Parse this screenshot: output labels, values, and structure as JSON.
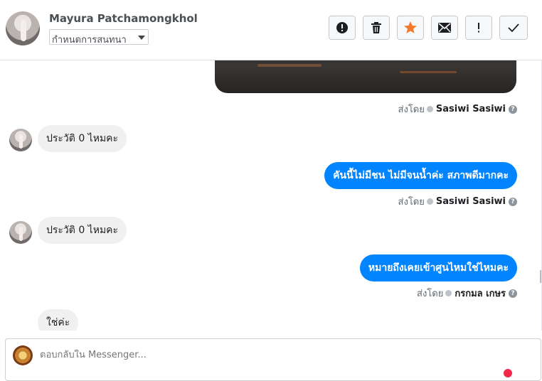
{
  "header": {
    "contact_name": "Mayura Patchamongkhol",
    "label_select": "กำหนดการสนทนา",
    "actions": [
      {
        "name": "spam",
        "icon": "exclamation-circle-icon"
      },
      {
        "name": "delete",
        "icon": "trash-icon"
      },
      {
        "name": "star",
        "icon": "star-icon"
      },
      {
        "name": "mark-unread",
        "icon": "envelope-icon"
      },
      {
        "name": "follow-up",
        "icon": "exclamation-icon"
      },
      {
        "name": "done",
        "icon": "check-icon"
      }
    ],
    "star_color": "#f5792a"
  },
  "messages": [
    {
      "type": "outgoing-photo",
      "sent_by_label": "ส่งโดย",
      "sender": "Sasiwi Sasiwi"
    },
    {
      "type": "incoming",
      "text": "ประวัติ 0 ไหมคะ"
    },
    {
      "type": "outgoing",
      "text": "คันนี้ไม่มีชน ไม่มีจนน้ำค่ะ สภาพดีมากคะ",
      "sent_by_label": "ส่งโดย",
      "sender": "Sasiwi Sasiwi"
    },
    {
      "type": "incoming",
      "text": "ประวัติ 0 ไหมคะ"
    },
    {
      "type": "outgoing",
      "text": "หมายถึงเคยเข้าศูนไหมใช่ไหมคะ",
      "sent_by_label": "ส่งโดย",
      "sender": "กรกมล เกษร"
    },
    {
      "type": "incoming",
      "text": "ใช่ค่ะ"
    }
  ],
  "composer": {
    "placeholder": "ตอบกลับใน Messenger..."
  },
  "colors": {
    "outgoing_bubble": "#0084ff",
    "incoming_bubble": "#f0f0f0"
  }
}
